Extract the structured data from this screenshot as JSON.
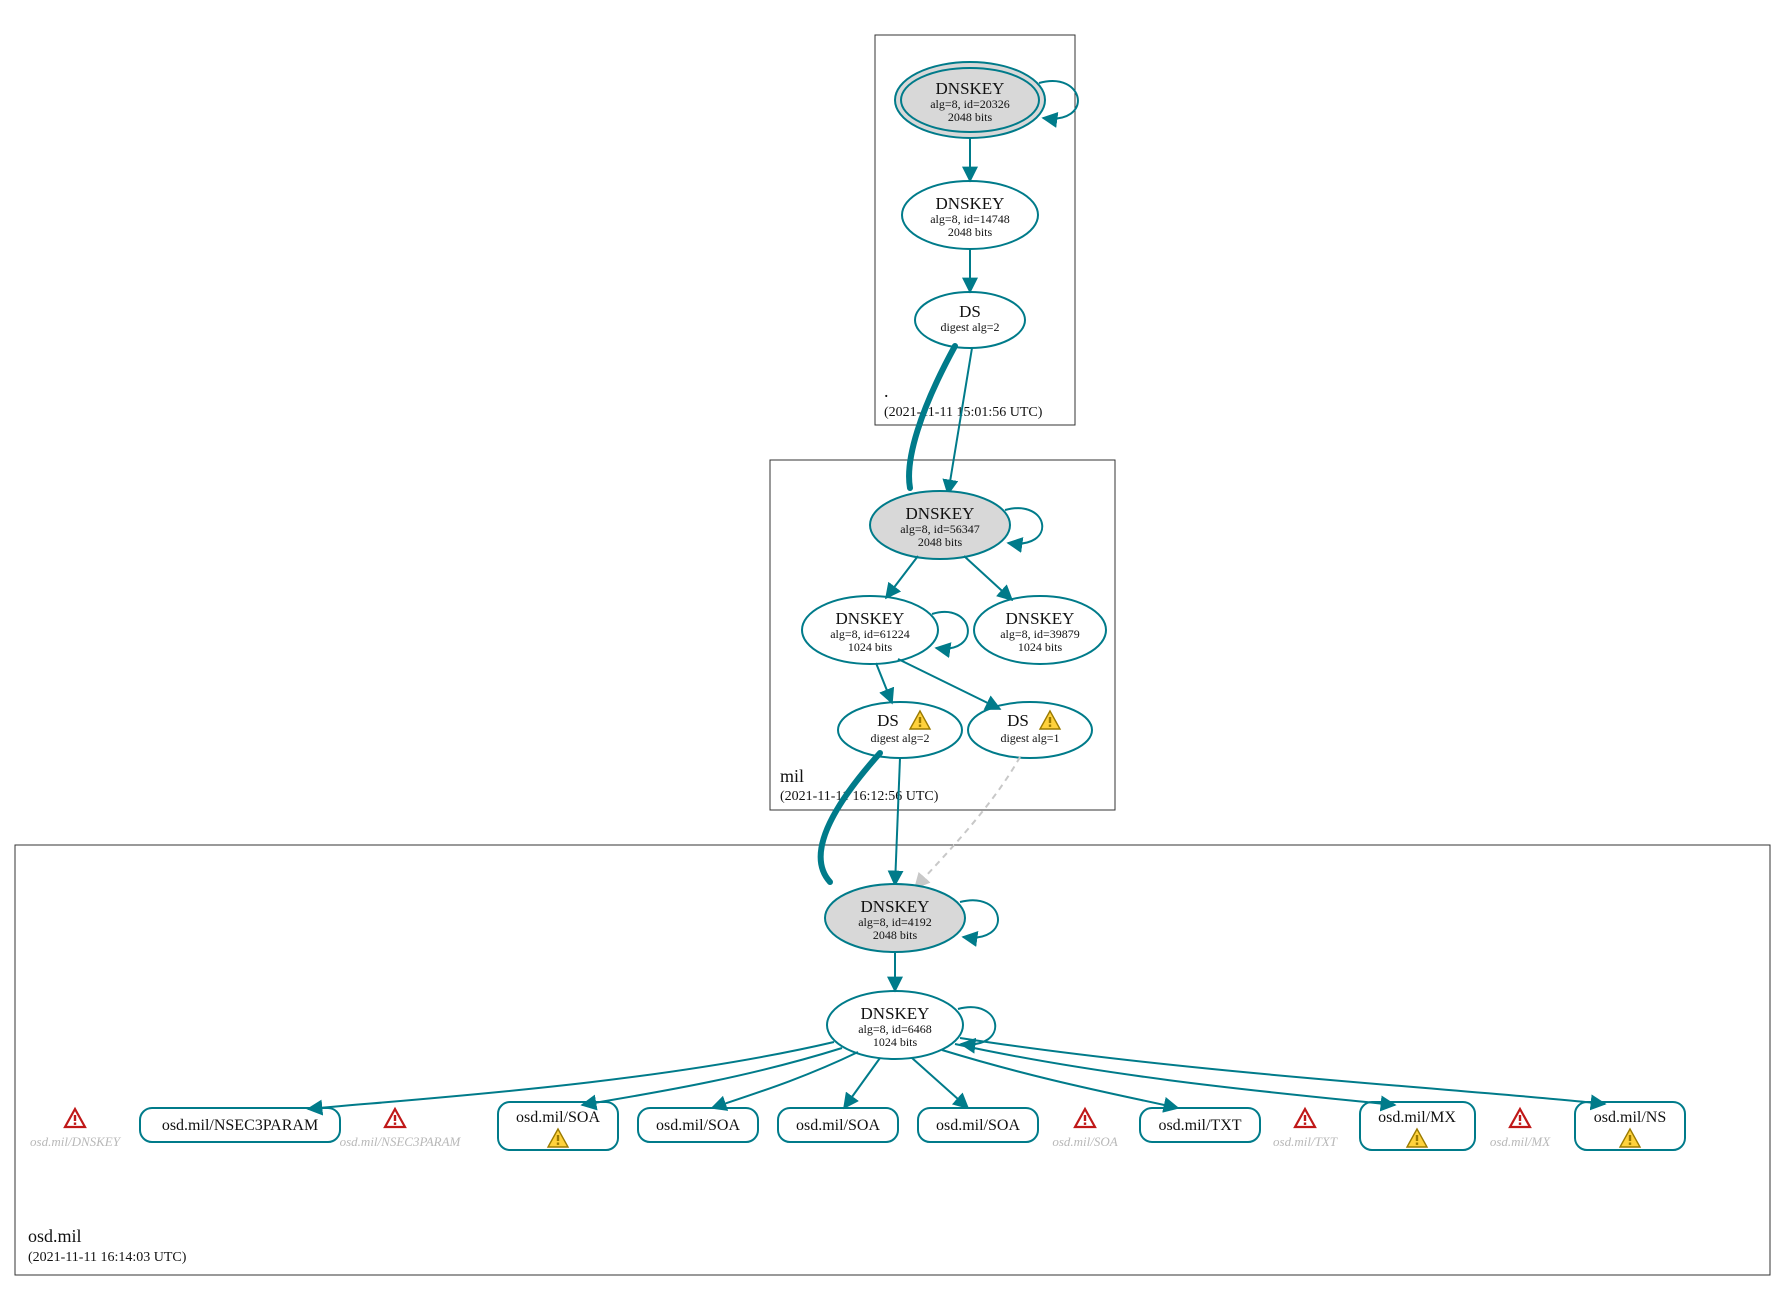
{
  "zones": {
    "root": {
      "name": ".",
      "timestamp": "(2021-11-11 15:01:56 UTC)"
    },
    "mil": {
      "name": "mil",
      "timestamp": "(2021-11-11 16:12:56 UTC)"
    },
    "osd": {
      "name": "osd.mil",
      "timestamp": "(2021-11-11 16:14:03 UTC)"
    }
  },
  "nodes": {
    "root_ksk": {
      "title": "DNSKEY",
      "line1": "alg=8, id=20326",
      "line2": "2048 bits"
    },
    "root_zsk": {
      "title": "DNSKEY",
      "line1": "alg=8, id=14748",
      "line2": "2048 bits"
    },
    "root_ds": {
      "title": "DS",
      "line1": "digest alg=2",
      "line2": ""
    },
    "mil_ksk": {
      "title": "DNSKEY",
      "line1": "alg=8, id=56347",
      "line2": "2048 bits"
    },
    "mil_zskL": {
      "title": "DNSKEY",
      "line1": "alg=8, id=61224",
      "line2": "1024 bits"
    },
    "mil_zskR": {
      "title": "DNSKEY",
      "line1": "alg=8, id=39879",
      "line2": "1024 bits"
    },
    "mil_dsL": {
      "title": "DS",
      "line1": "digest alg=2",
      "line2": ""
    },
    "mil_dsR": {
      "title": "DS",
      "line1": "digest alg=1",
      "line2": ""
    },
    "osd_ksk": {
      "title": "DNSKEY",
      "line1": "alg=8, id=4192",
      "line2": "2048 bits"
    },
    "osd_zsk": {
      "title": "DNSKEY",
      "line1": "alg=8, id=6468",
      "line2": "1024 bits"
    }
  },
  "rr": {
    "nsec3p": "osd.mil/NSEC3PARAM",
    "soa1": "osd.mil/SOA",
    "soa2": "osd.mil/SOA",
    "soa3": "osd.mil/SOA",
    "soa4": "osd.mil/SOA",
    "txt": "osd.mil/TXT",
    "mx": "osd.mil/MX",
    "ns": "osd.mil/NS"
  },
  "ghosts": {
    "dnskey": "osd.mil/DNSKEY",
    "nsec3param": "osd.mil/NSEC3PARAM",
    "soa": "osd.mil/SOA",
    "txt": "osd.mil/TXT",
    "mx": "osd.mil/MX"
  },
  "colors": {
    "stroke": "#007b8a",
    "ksk_fill": "#d8d8d8",
    "ghost": "#b8b8b8",
    "warn_fill": "#ffd23c",
    "warn_stroke": "#9b7b00",
    "err_stroke": "#c01818"
  }
}
